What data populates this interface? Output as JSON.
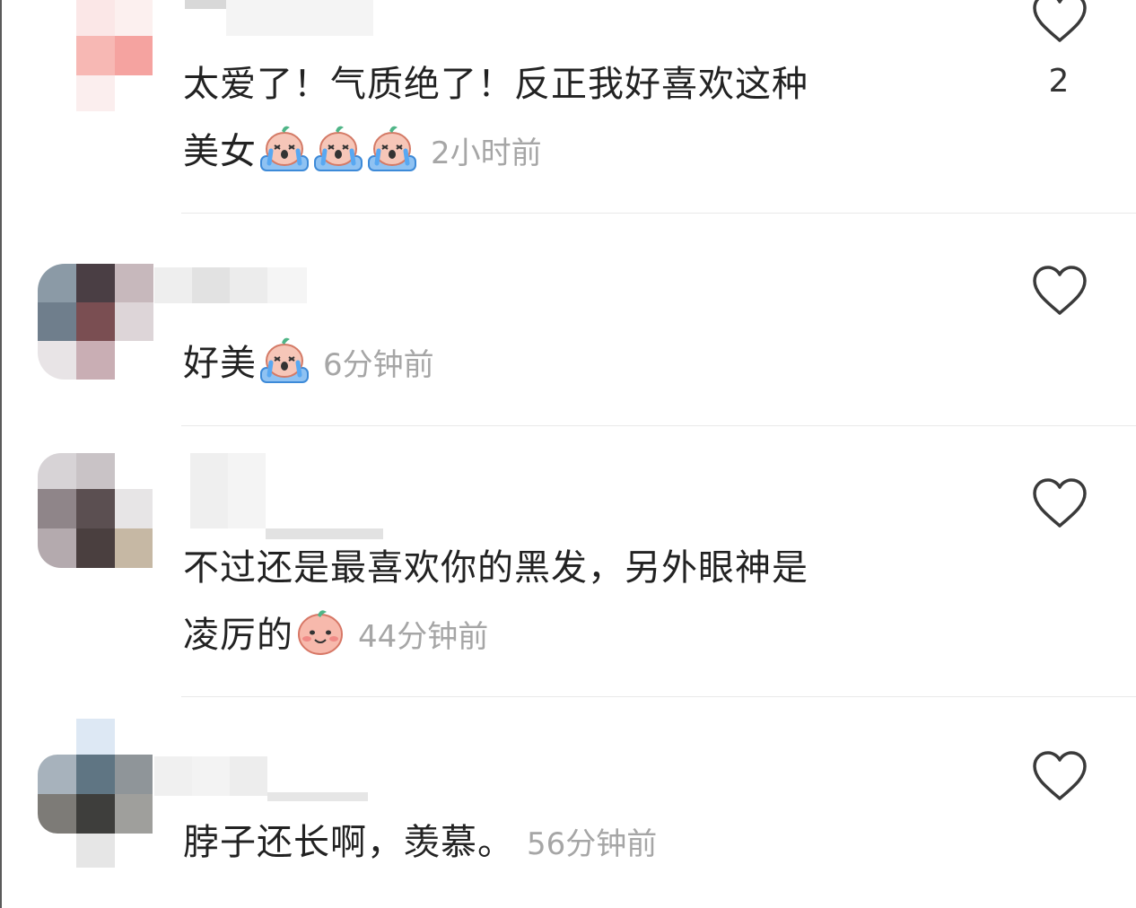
{
  "comments": [
    {
      "text_line1": "太爱了！气质绝了！反正我好喜欢这种",
      "text_line2": "美女",
      "emojis": [
        "crying-laughing-emoji",
        "crying-laughing-emoji",
        "crying-laughing-emoji"
      ],
      "time": "2小时前",
      "like_count": "2",
      "avatar_colors": [
        "#fbe7e7",
        "#f7b8b4",
        "#f5a3a0",
        "#fbeeee"
      ]
    },
    {
      "text_line1": "好美",
      "emojis": [
        "crying-laughing-emoji"
      ],
      "time": "6分钟前",
      "like_count": "",
      "avatar_colors": [
        "#8b9aa6",
        "#4a3e44",
        "#c7b8bc",
        "#6f7e8c",
        "#7a4e52",
        "#ddd5d8",
        "#e8e4e6",
        "#c9aeb4"
      ]
    },
    {
      "text_line1": "不过还是最喜欢你的黑发，另外眼神是",
      "text_line2": "凌厉的",
      "emojis": [
        "blushing-smile-emoji"
      ],
      "time": "44分钟前",
      "like_count": "",
      "avatar_colors": [
        "#d7d3d6",
        "#5b4f51",
        "#8f8589",
        "#4a3f3f",
        "#b4aaae",
        "#c6b8a4",
        "#e3e0e2"
      ]
    },
    {
      "text_line1": "脖子还长啊，羡慕。",
      "time": "56分钟前",
      "like_count": "",
      "avatar_colors": [
        "#dde8f4",
        "#a7b2bc",
        "#5f7583",
        "#8f9599",
        "#7d7b77",
        "#3e3e3c",
        "#9f9f9c",
        "#e6e6e6"
      ]
    }
  ],
  "colors": {
    "text": "#222222",
    "time": "#a6a6a6",
    "divider": "#e9e9e9",
    "heart_outline": "#3a3a3a"
  }
}
